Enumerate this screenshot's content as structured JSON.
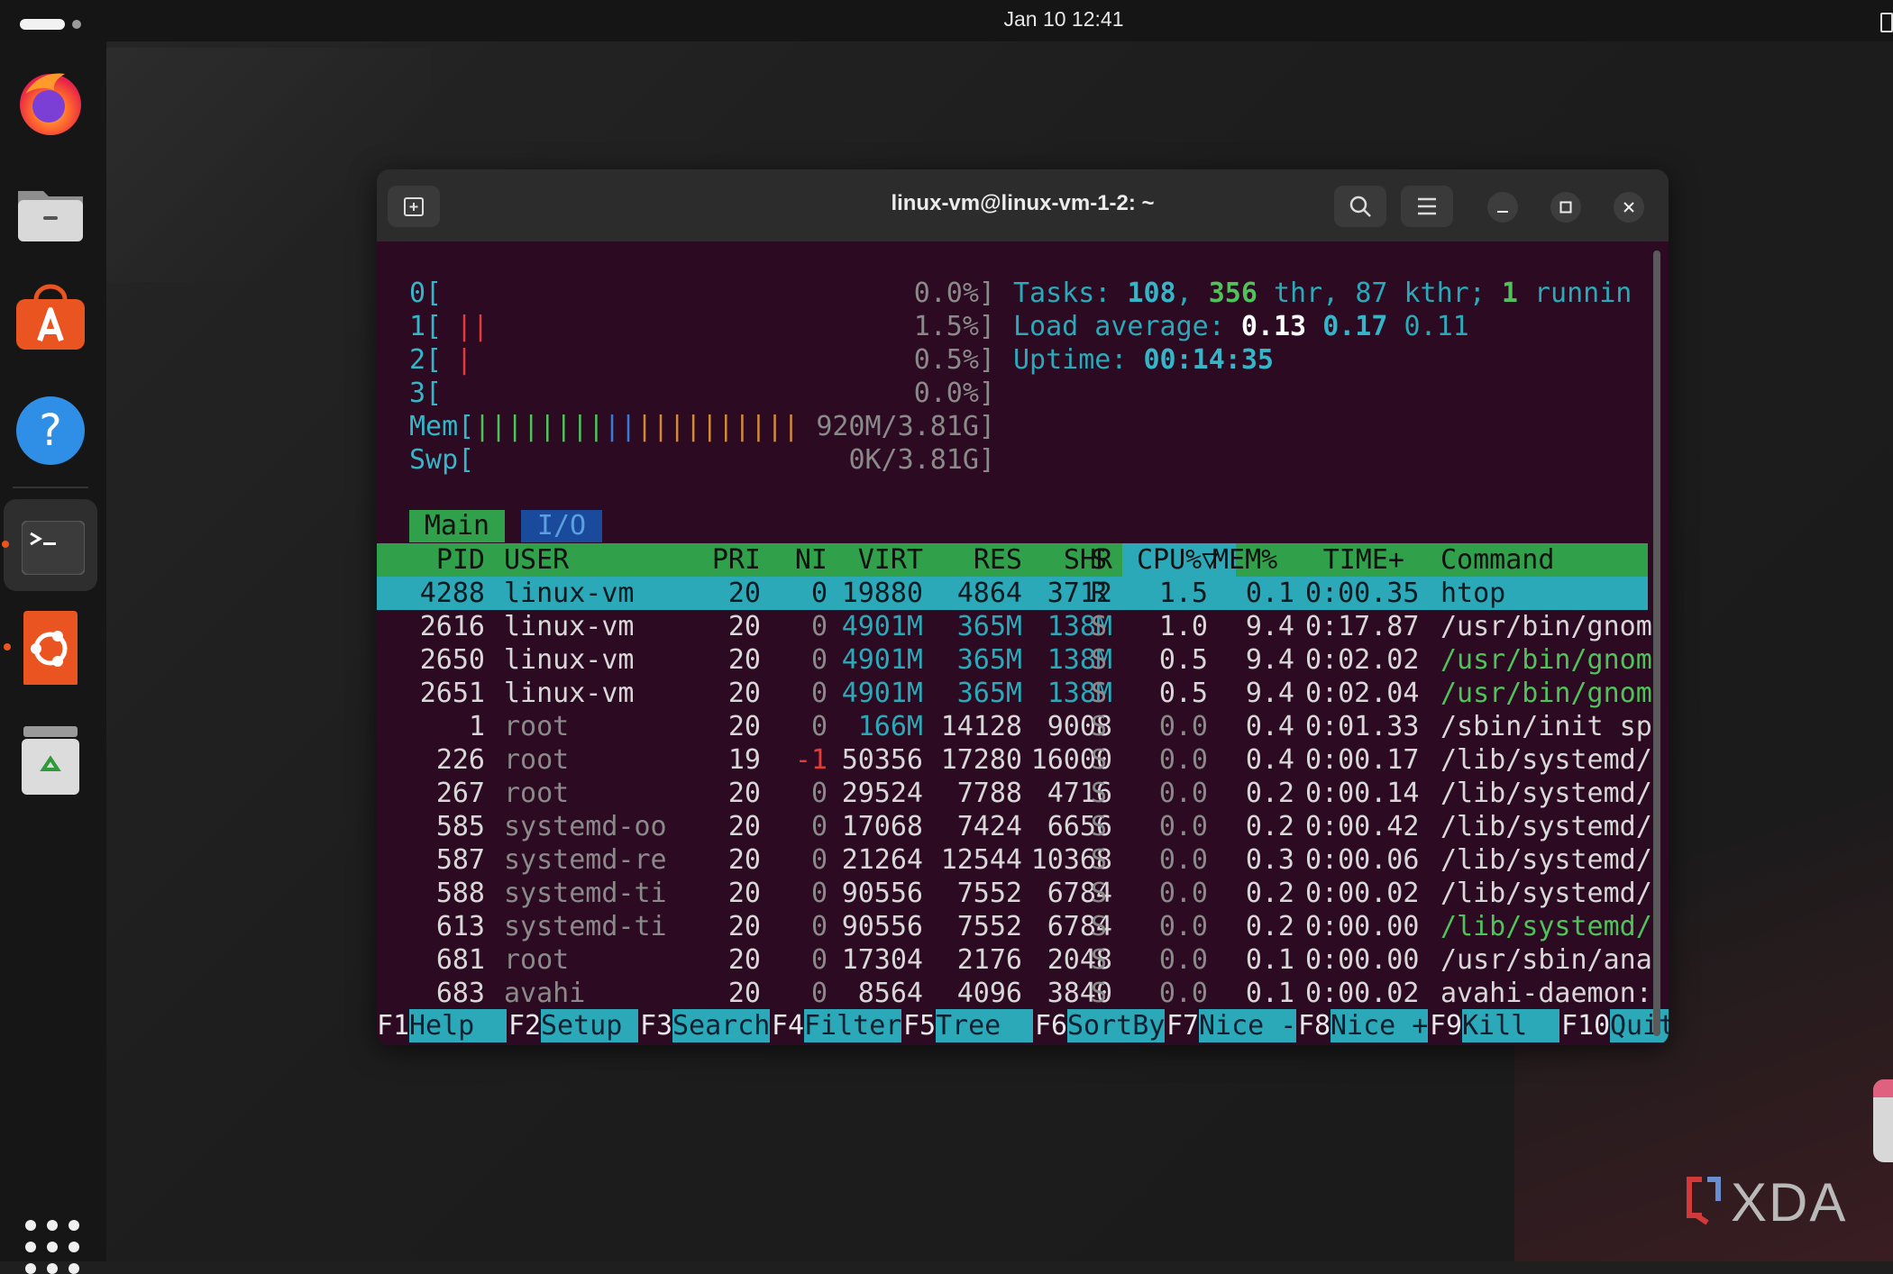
{
  "topbar": {
    "clock": "Jan 10  12:41"
  },
  "dock": {
    "items": [
      "Firefox",
      "Files",
      "App Center",
      "Help",
      "Terminal",
      "Ubuntu Software",
      "Trash",
      "Show Apps"
    ]
  },
  "window": {
    "title": "linux-vm@linux-vm-1-2: ~"
  },
  "htop": {
    "cpus": [
      {
        "label": "0[",
        "bars": "",
        "pct": "0.0%]"
      },
      {
        "label": "1[",
        "bars": "||",
        "pct": "1.5%]"
      },
      {
        "label": "2[",
        "bars": "|",
        "pct": "0.5%]"
      },
      {
        "label": "3[",
        "bars": "",
        "pct": "0.0%]"
      }
    ],
    "mem": {
      "label": "Mem[",
      "bars_green": "||||||||",
      "bars_blue": "||",
      "bars_orange": "||||||||||",
      "value": "920M/3.81G]"
    },
    "swp": {
      "label": "Swp[",
      "value": "0K/3.81G]"
    },
    "tasks": {
      "prefix": "Tasks: ",
      "tasks": "108",
      "comma1": ", ",
      "thr": "356",
      "thr_label": " thr, ",
      "kthr": "87",
      "kthr_label": " kthr; ",
      "running": "1",
      "running_label": " runnin"
    },
    "load": {
      "prefix": "Load average: ",
      "l1": "0.13",
      "l5": "0.17",
      "l15": "0.11"
    },
    "uptime": {
      "prefix": "Uptime: ",
      "value": "00:14:35"
    },
    "tabs": {
      "main": "Main",
      "io": "I/O"
    },
    "columns": {
      "pid": "PID",
      "user": "USER",
      "pri": "PRI",
      "ni": "NI",
      "virt": "VIRT",
      "res": "RES",
      "shr": "SHR",
      "s": "S",
      "cpu": "CPU%▽",
      "mem": "MEM%",
      "time": "TIME+",
      "command": "Command"
    },
    "processes": [
      {
        "pid": "4288",
        "user": "linux-vm",
        "pri": "20",
        "ni": "0",
        "virt": "19880",
        "res": "4864",
        "shr": "3712",
        "s": "R",
        "cpu": "1.5",
        "mem": "0.1",
        "time": "0:00.35",
        "command": "htop"
      },
      {
        "pid": "2616",
        "user": "linux-vm",
        "pri": "20",
        "ni": "0",
        "virt": "4901M",
        "res": "365M",
        "shr": "138M",
        "s": "S",
        "cpu": "1.0",
        "mem": "9.4",
        "time": "0:17.87",
        "command": "/usr/bin/gnom"
      },
      {
        "pid": "2650",
        "user": "linux-vm",
        "pri": "20",
        "ni": "0",
        "virt": "4901M",
        "res": "365M",
        "shr": "138M",
        "s": "S",
        "cpu": "0.5",
        "mem": "9.4",
        "time": "0:02.02",
        "command": "/usr/bin/gnom"
      },
      {
        "pid": "2651",
        "user": "linux-vm",
        "pri": "20",
        "ni": "0",
        "virt": "4901M",
        "res": "365M",
        "shr": "138M",
        "s": "S",
        "cpu": "0.5",
        "mem": "9.4",
        "time": "0:02.04",
        "command": "/usr/bin/gnom"
      },
      {
        "pid": "1",
        "user": "root",
        "pri": "20",
        "ni": "0",
        "virt": "166M",
        "res": "14128",
        "shr": "9008",
        "s": "S",
        "cpu": "0.0",
        "mem": "0.4",
        "time": "0:01.33",
        "command": "/sbin/init sp"
      },
      {
        "pid": "226",
        "user": "root",
        "pri": "19",
        "ni": "-1",
        "virt": "50356",
        "res": "17280",
        "shr": "16000",
        "s": "S",
        "cpu": "0.0",
        "mem": "0.4",
        "time": "0:00.17",
        "command": "/lib/systemd/"
      },
      {
        "pid": "267",
        "user": "root",
        "pri": "20",
        "ni": "0",
        "virt": "29524",
        "res": "7788",
        "shr": "4716",
        "s": "S",
        "cpu": "0.0",
        "mem": "0.2",
        "time": "0:00.14",
        "command": "/lib/systemd/"
      },
      {
        "pid": "585",
        "user": "systemd-oo",
        "pri": "20",
        "ni": "0",
        "virt": "17068",
        "res": "7424",
        "shr": "6656",
        "s": "S",
        "cpu": "0.0",
        "mem": "0.2",
        "time": "0:00.42",
        "command": "/lib/systemd/"
      },
      {
        "pid": "587",
        "user": "systemd-re",
        "pri": "20",
        "ni": "0",
        "virt": "21264",
        "res": "12544",
        "shr": "10368",
        "s": "S",
        "cpu": "0.0",
        "mem": "0.3",
        "time": "0:00.06",
        "command": "/lib/systemd/"
      },
      {
        "pid": "588",
        "user": "systemd-ti",
        "pri": "20",
        "ni": "0",
        "virt": "90556",
        "res": "7552",
        "shr": "6784",
        "s": "S",
        "cpu": "0.0",
        "mem": "0.2",
        "time": "0:00.02",
        "command": "/lib/systemd/"
      },
      {
        "pid": "613",
        "user": "systemd-ti",
        "pri": "20",
        "ni": "0",
        "virt": "90556",
        "res": "7552",
        "shr": "6784",
        "s": "S",
        "cpu": "0.0",
        "mem": "0.2",
        "time": "0:00.00",
        "command": "/lib/systemd/"
      },
      {
        "pid": "681",
        "user": "root",
        "pri": "20",
        "ni": "0",
        "virt": "17304",
        "res": "2176",
        "shr": "2048",
        "s": "S",
        "cpu": "0.0",
        "mem": "0.1",
        "time": "0:00.00",
        "command": "/usr/sbin/ana"
      },
      {
        "pid": "683",
        "user": "avahi",
        "pri": "20",
        "ni": "0",
        "virt": "8564",
        "res": "4096",
        "shr": "3840",
        "s": "S",
        "cpu": "0.0",
        "mem": "0.1",
        "time": "0:00.02",
        "command": "avahi-daemon:"
      }
    ],
    "fkeys": [
      {
        "key": "F1",
        "label": "Help  "
      },
      {
        "key": "F2",
        "label": "Setup "
      },
      {
        "key": "F3",
        "label": "Search"
      },
      {
        "key": "F4",
        "label": "Filter"
      },
      {
        "key": "F5",
        "label": "Tree  "
      },
      {
        "key": "F6",
        "label": "SortBy"
      },
      {
        "key": "F7",
        "label": "Nice -"
      },
      {
        "key": "F8",
        "label": "Nice +"
      },
      {
        "key": "F9",
        "label": "Kill  "
      },
      {
        "key": "F10",
        "label": "Quit "
      }
    ]
  },
  "watermark": {
    "text": "XDA"
  },
  "colors": {
    "terminal_bg": "#2c0a22",
    "accent_teal": "#2ba9b8",
    "header_green": "#30a04a",
    "ubuntu_orange": "#e95420"
  }
}
